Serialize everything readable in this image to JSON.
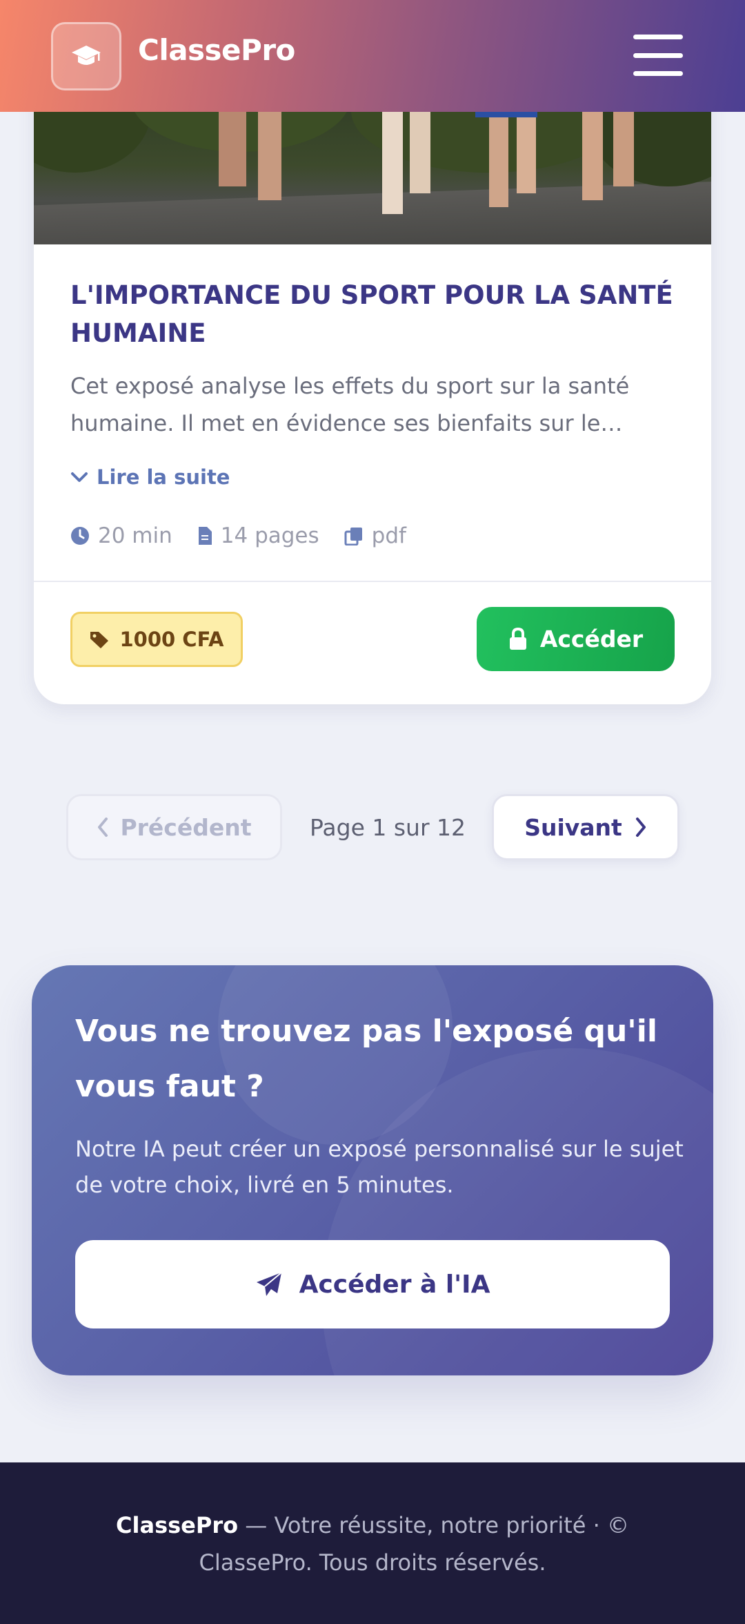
{
  "header": {
    "brand": "ClassePro",
    "logo_icon": "graduation-cap-icon",
    "menu_icon": "hamburger-menu-icon"
  },
  "card": {
    "title": "L'IMPORTANCE DU SPORT POUR LA SANTÉ HUMAINE",
    "description": "Cet exposé analyse les effets du sport sur la santé humaine. Il met en évidence ses bienfaits sur le…",
    "read_more": "Lire la suite",
    "meta": {
      "duration": "20 min",
      "pages": "14 pages",
      "format": "pdf"
    },
    "price": "1000 CFA",
    "access_label": "Accéder"
  },
  "pagination": {
    "prev_label": "Précédent",
    "info": "Page 1 sur 12",
    "next_label": "Suivant"
  },
  "cta": {
    "title": "Vous ne trouvez pas l'exposé qu'il vous faut ?",
    "text": "Notre IA peut créer un exposé personnalisé sur le sujet de votre choix, livré en 5 minutes.",
    "button_label": "Accéder à l'IA"
  },
  "footer": {
    "brand": "ClassePro",
    "text": " — Votre réussite, notre priorité · © ClassePro. Tous droits réservés."
  },
  "colors": {
    "primary": "#3b3685",
    "accent_green": "#16a34a",
    "badge_bg": "#fdeeaa",
    "footer_bg": "#1e1c3a"
  }
}
